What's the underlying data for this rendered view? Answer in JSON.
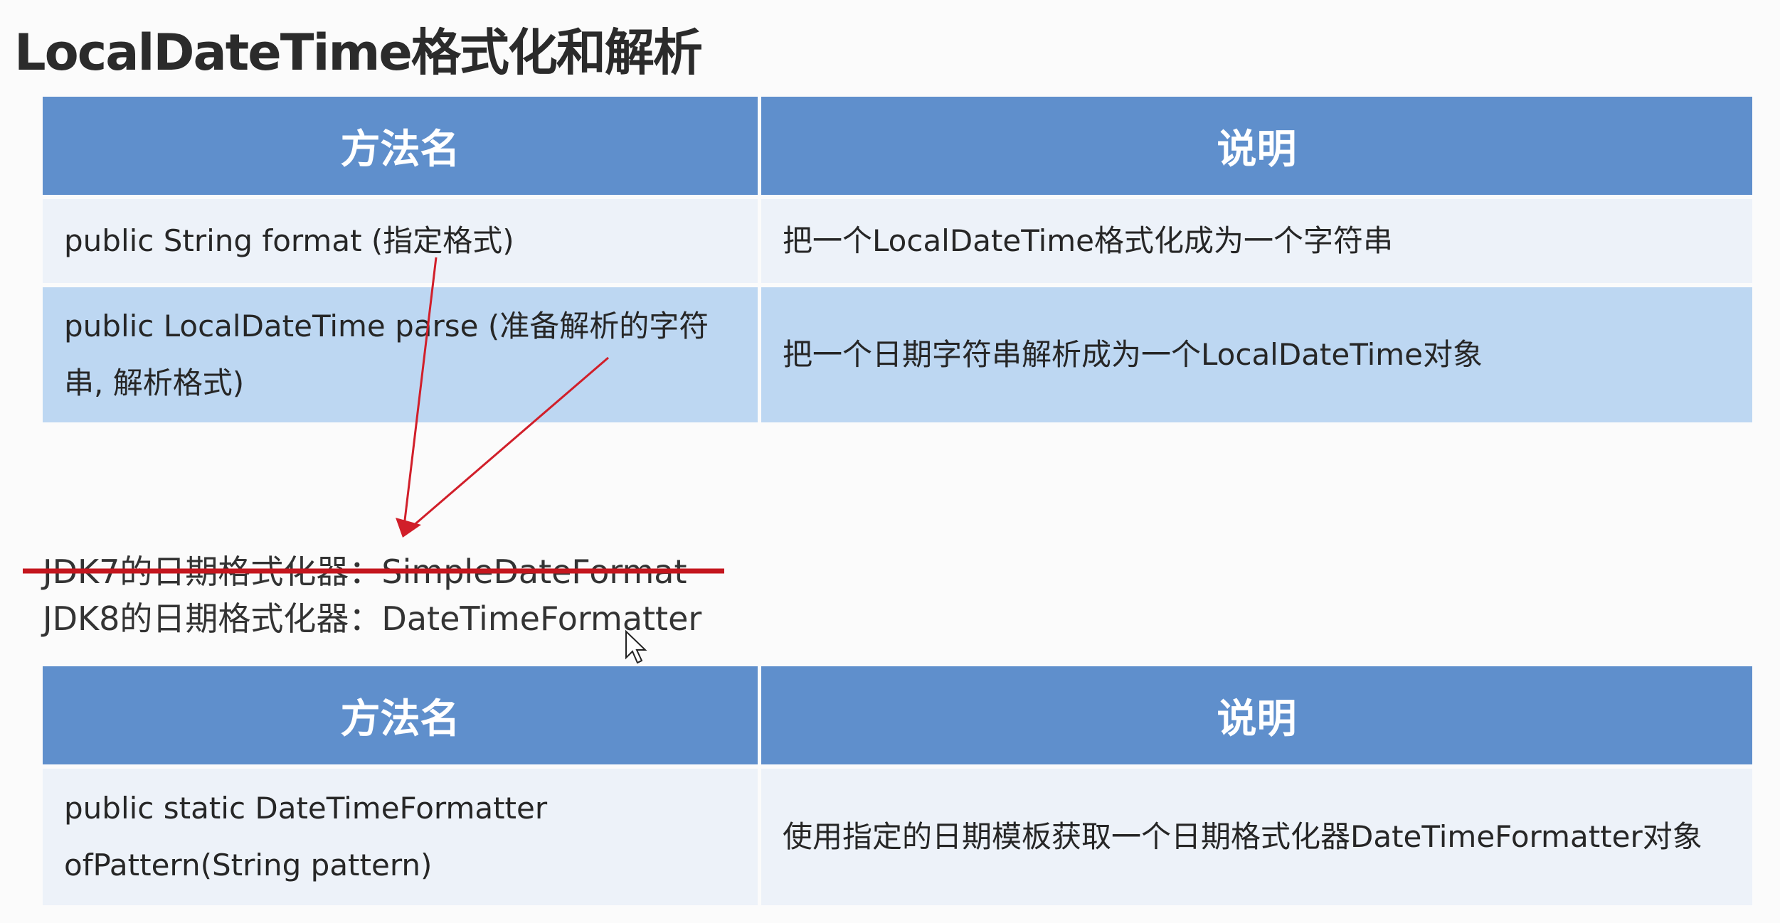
{
  "title": "LocalDateTime格式化和解析",
  "table1": {
    "headers": [
      "方法名",
      "说明"
    ],
    "rows": [
      [
        "public String format (指定格式)",
        "把一个LocalDateTime格式化成为一个字符串"
      ],
      [
        "public LocalDateTime parse (准备解析的字符串, 解析格式)",
        "把一个日期字符串解析成为一个LocalDateTime对象"
      ]
    ]
  },
  "notes": {
    "jdk7": "JDK7的日期格式化器：SimpleDateFormat",
    "jdk8": "JDK8的日期格式化器：DateTimeFormatter"
  },
  "table2": {
    "headers": [
      "方法名",
      "说明"
    ],
    "rows": [
      [
        "public static DateTimeFormatter ofPattern(String pattern)",
        "使用指定的日期模板获取一个日期格式化器DateTimeFormatter对象"
      ]
    ]
  },
  "colors": {
    "header": "#5f8fcc",
    "row_light": "#edf2f9",
    "row_dark": "#bdd7f2",
    "annotation": "#d11f2a"
  }
}
